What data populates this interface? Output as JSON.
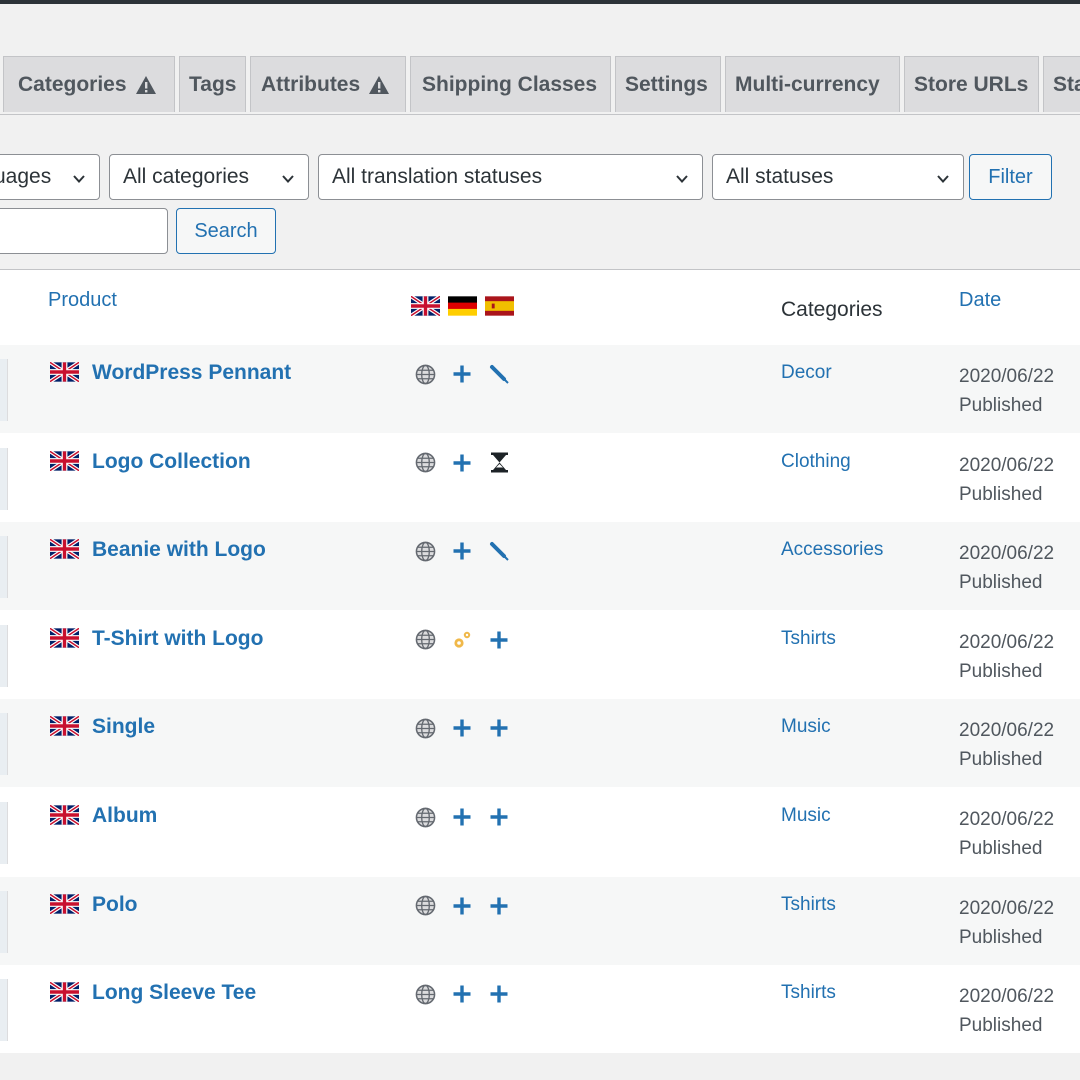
{
  "tabs": [
    {
      "label": "Categories",
      "warning": true
    },
    {
      "label": "Tags",
      "warning": false
    },
    {
      "label": "Attributes",
      "warning": true
    },
    {
      "label": "Shipping Classes",
      "warning": false
    },
    {
      "label": "Settings",
      "warning": false
    },
    {
      "label": "Multi-currency",
      "warning": false
    },
    {
      "label": "Store URLs",
      "warning": false
    },
    {
      "label": "Sta",
      "warning": false
    }
  ],
  "filters": {
    "languages_value": "uages",
    "category_value": "All categories",
    "translation_status_value": "All translation statuses",
    "status_value": "All statuses",
    "filter_button": "Filter",
    "search_value": "",
    "search_button": "Search"
  },
  "table": {
    "columns": {
      "product": "Product",
      "languages_icons": [
        "flag-uk-icon",
        "flag-de-icon",
        "flag-es-icon"
      ],
      "categories": "Categories",
      "date": "Date"
    },
    "rows": [
      {
        "name": "WordPress Pennant",
        "actions": [
          "globe-icon",
          "plus-icon",
          "pencil-icon"
        ],
        "category": "Decor",
        "date": "2020/06/22",
        "status": "Published"
      },
      {
        "name": "Logo Collection",
        "actions": [
          "globe-icon",
          "plus-icon",
          "hourglass-icon"
        ],
        "category": "Clothing",
        "date": "2020/06/22",
        "status": "Published"
      },
      {
        "name": "Beanie with Logo",
        "actions": [
          "globe-icon",
          "plus-icon",
          "pencil-icon"
        ],
        "category": "Accessories",
        "date": "2020/06/22",
        "status": "Published"
      },
      {
        "name": "T-Shirt with Logo",
        "actions": [
          "globe-icon",
          "gears-icon",
          "plus-icon"
        ],
        "category": "Tshirts",
        "date": "2020/06/22",
        "status": "Published"
      },
      {
        "name": "Single",
        "actions": [
          "globe-icon",
          "plus-icon",
          "plus-icon"
        ],
        "category": "Music",
        "date": "2020/06/22",
        "status": "Published"
      },
      {
        "name": "Album",
        "actions": [
          "globe-icon",
          "plus-icon",
          "plus-icon"
        ],
        "category": "Music",
        "date": "2020/06/22",
        "status": "Published"
      },
      {
        "name": "Polo",
        "actions": [
          "globe-icon",
          "plus-icon",
          "plus-icon"
        ],
        "category": "Tshirts",
        "date": "2020/06/22",
        "status": "Published"
      },
      {
        "name": "Long Sleeve Tee",
        "actions": [
          "globe-icon",
          "plus-icon",
          "plus-icon"
        ],
        "category": "Tshirts",
        "date": "2020/06/22",
        "status": "Published"
      }
    ]
  },
  "colors": {
    "link": "#2271b1",
    "tab_bg": "#dcdcde",
    "row_alt": "#f6f7f7",
    "status_in_progress": "#f0b849"
  }
}
